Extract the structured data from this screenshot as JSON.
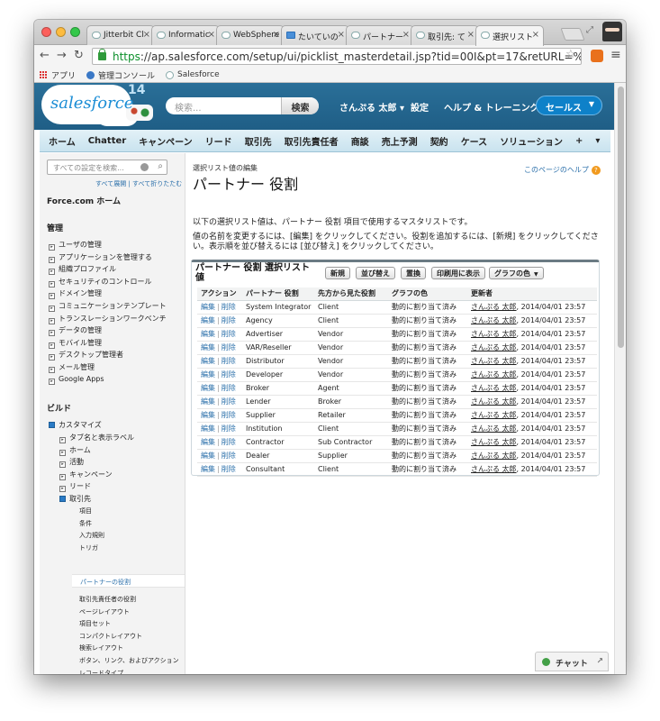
{
  "browser": {
    "tabs": [
      {
        "label": "Jitterbit Cl"
      },
      {
        "label": "Informatic"
      },
      {
        "label": "WebSphere"
      },
      {
        "label": "たいていの"
      },
      {
        "label": "パートナー"
      },
      {
        "label": "取引先: て"
      },
      {
        "label": "選択リスト"
      }
    ],
    "url_scheme": "https",
    "url_rest": "://ap.salesforce.com/setup/ui/picklist_masterdetail.jsp?tid=00I&pt=17&retURL=%2Fui%2Fsetup%2FSe...",
    "bookmarks": [
      "アプリ",
      "管理コンソール",
      "Salesforce"
    ]
  },
  "header": {
    "logo_text": "salesforce",
    "version": "14",
    "search_placeholder": "検索...",
    "search_button": "検索",
    "user": "さんぷる 太郎 ▾",
    "settings": "設定",
    "help": "ヘルプ & トレーニング",
    "app": "セールス"
  },
  "nav_tabs": [
    "ホーム",
    "Chatter",
    "キャンペーン",
    "リード",
    "取引先",
    "取引先責任者",
    "商談",
    "売上予測",
    "契約",
    "ケース",
    "ソリューション",
    "+",
    "▾"
  ],
  "sidebar": {
    "search_placeholder": "すべての設定を検索...",
    "expand_collapse": "すべて展開 | すべて折りたたむ",
    "home": "Force.com ホーム",
    "admin_header": "管理",
    "admin_items": [
      "ユーザの管理",
      "アプリケーションを管理する",
      "組織プロファイル",
      "セキュリティのコントロール",
      "ドメイン管理",
      "コミュニケーションテンプレート",
      "トランスレーションワークベンチ",
      "データの管理",
      "モバイル管理",
      "デスクトップ管理者",
      "メール管理",
      "Google Apps"
    ],
    "build_header": "ビルド",
    "customize": "カスタマイズ",
    "customize_items": [
      "タブ名と表示ラベル",
      "ホーム",
      "活動",
      "キャンペーン",
      "リード",
      "取引先"
    ],
    "account_items": [
      "項目",
      "条件",
      "入力規則",
      "トリガ"
    ],
    "selected_item": "パートナーの役割",
    "more_items": [
      "取引先責任者の役割",
      "ページレイアウト",
      "項目セット",
      "コンパクトレイアウト",
      "検索レイアウト",
      "ボタン、リンク、およびアクション",
      "レコードタイプ",
      "制限"
    ]
  },
  "main": {
    "breadcrumb": "選択リスト値の編集",
    "title": "パートナー 役割",
    "help_link": "このページのヘルプ",
    "description": "以下の選択リスト値は、パートナー 役割 項目で使用するマスタリストです。",
    "instructions": "値の名前を変更するには、[編集] をクリックしてください。役割を追加するには、[新規] をクリックしてください。表示順を並び替えるには [並び替え] をクリックしてください。",
    "block_title": "パートナー 役割 選択リスト値",
    "buttons": {
      "new": "新規",
      "reorder": "並び替え",
      "replace": "置換",
      "print": "印刷用に表示",
      "chart_color": "グラフの色"
    },
    "columns": [
      "アクション",
      "パートナー 役割",
      "先方から見た役割",
      "グラフの色",
      "更新者"
    ],
    "edit_label": "編集",
    "delete_label": "削除",
    "rows": [
      {
        "role": "System Integrator",
        "reverse": "Client",
        "color": "動的に割り当て済み",
        "modified": "さんぷる 太郎",
        "date": ", 2014/04/01 23:57"
      },
      {
        "role": "Agency",
        "reverse": "Client",
        "color": "動的に割り当て済み",
        "modified": "さんぷる 太郎",
        "date": ", 2014/04/01 23:57"
      },
      {
        "role": "Advertiser",
        "reverse": "Vendor",
        "color": "動的に割り当て済み",
        "modified": "さんぷる 太郎",
        "date": ", 2014/04/01 23:57"
      },
      {
        "role": "VAR/Reseller",
        "reverse": "Vendor",
        "color": "動的に割り当て済み",
        "modified": "さんぷる 太郎",
        "date": ", 2014/04/01 23:57"
      },
      {
        "role": "Distributor",
        "reverse": "Vendor",
        "color": "動的に割り当て済み",
        "modified": "さんぷる 太郎",
        "date": ", 2014/04/01 23:57"
      },
      {
        "role": "Developer",
        "reverse": "Vendor",
        "color": "動的に割り当て済み",
        "modified": "さんぷる 太郎",
        "date": ", 2014/04/01 23:57"
      },
      {
        "role": "Broker",
        "reverse": "Agent",
        "color": "動的に割り当て済み",
        "modified": "さんぷる 太郎",
        "date": ", 2014/04/01 23:57"
      },
      {
        "role": "Lender",
        "reverse": "Broker",
        "color": "動的に割り当て済み",
        "modified": "さんぷる 太郎",
        "date": ", 2014/04/01 23:57"
      },
      {
        "role": "Supplier",
        "reverse": "Retailer",
        "color": "動的に割り当て済み",
        "modified": "さんぷる 太郎",
        "date": ", 2014/04/01 23:57"
      },
      {
        "role": "Institution",
        "reverse": "Client",
        "color": "動的に割り当て済み",
        "modified": "さんぷる 太郎",
        "date": ", 2014/04/01 23:57"
      },
      {
        "role": "Contractor",
        "reverse": "Sub Contractor",
        "color": "動的に割り当て済み",
        "modified": "さんぷる 太郎",
        "date": ", 2014/04/01 23:57"
      },
      {
        "role": "Dealer",
        "reverse": "Supplier",
        "color": "動的に割り当て済み",
        "modified": "さんぷる 太郎",
        "date": ", 2014/04/01 23:57"
      },
      {
        "role": "Consultant",
        "reverse": "Client",
        "color": "動的に割り当て済み",
        "modified": "さんぷる 太郎",
        "date": ", 2014/04/01 23:57"
      }
    ]
  },
  "chat": {
    "label": "チャット"
  },
  "colors": {
    "header_blue": "#1f5e86",
    "link_blue": "#2a6faa",
    "tab_bar": "#c9e3ef"
  }
}
